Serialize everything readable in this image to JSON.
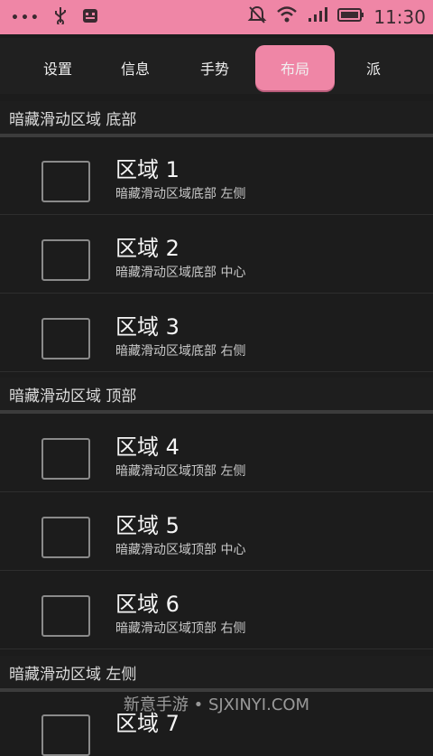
{
  "status_bar": {
    "time": "11:30",
    "dots": "•••",
    "icons": [
      "usb-icon",
      "android-debug-icon",
      "muted-bell-icon",
      "wifi-icon",
      "signal-icon",
      "battery-icon"
    ]
  },
  "tabs": [
    {
      "label": "设置",
      "active": false
    },
    {
      "label": "信息",
      "active": false
    },
    {
      "label": "手势",
      "active": false
    },
    {
      "label": "布局",
      "active": true
    },
    {
      "label": "派",
      "active": false
    }
  ],
  "sections": [
    {
      "header": "暗藏滑动区域 底部",
      "rows": [
        {
          "title": "区域 1",
          "subtitle": "暗藏滑动区域底部 左侧"
        },
        {
          "title": "区域 2",
          "subtitle": "暗藏滑动区域底部 中心"
        },
        {
          "title": "区域 3",
          "subtitle": "暗藏滑动区域底部 右侧"
        }
      ]
    },
    {
      "header": "暗藏滑动区域 顶部",
      "rows": [
        {
          "title": "区域 4",
          "subtitle": "暗藏滑动区域顶部 左侧"
        },
        {
          "title": "区域 5",
          "subtitle": "暗藏滑动区域顶部 中心"
        },
        {
          "title": "区域 6",
          "subtitle": "暗藏滑动区域顶部 右侧"
        }
      ]
    },
    {
      "header": "暗藏滑动区域 左侧",
      "rows": [
        {
          "title": "区域 7",
          "subtitle": ""
        }
      ]
    }
  ],
  "watermark": "新意手游 • SJXINYI.COM",
  "colors": {
    "accent": "#ef86a6",
    "background": "#1c1c1c"
  }
}
